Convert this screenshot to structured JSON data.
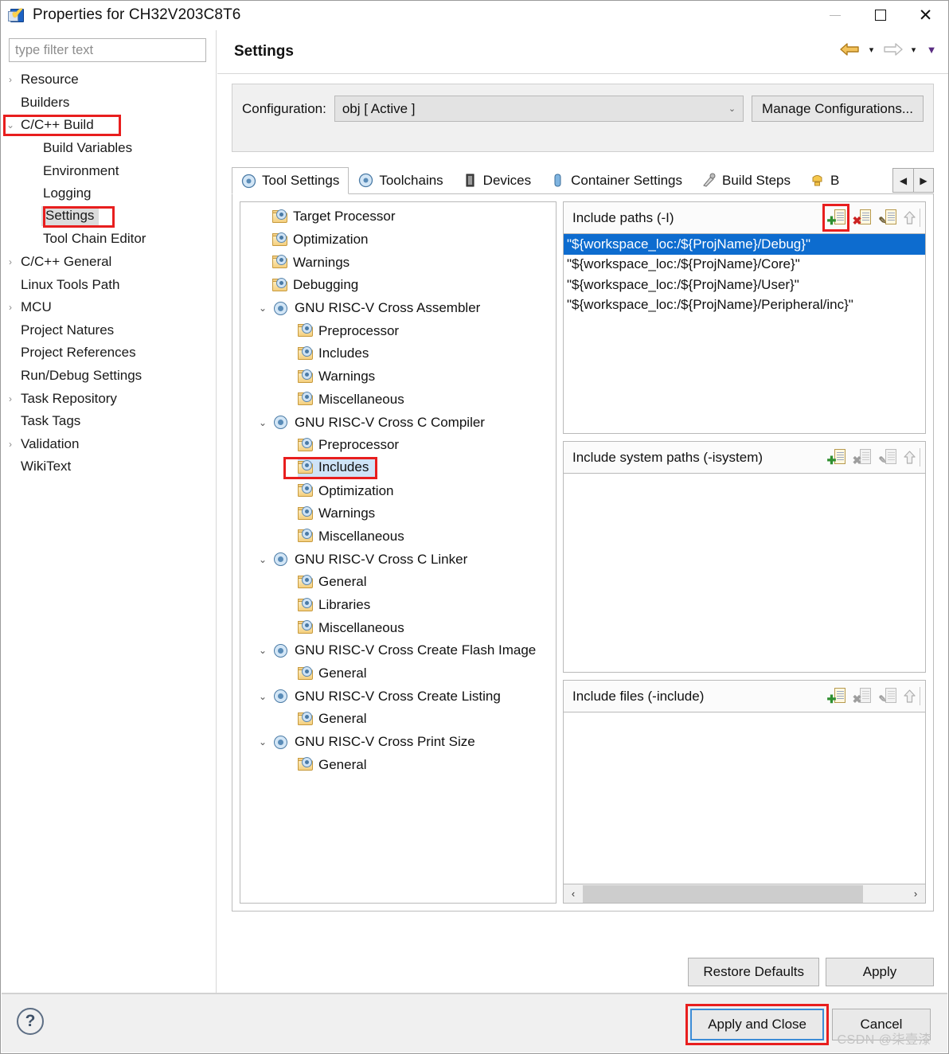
{
  "window": {
    "title": "Properties for CH32V203C8T6",
    "app_icon": "checkmark-app-icon",
    "minimize": "–",
    "maximize": "□",
    "close": "✕"
  },
  "sidebar": {
    "filter_placeholder": "type filter text",
    "filter_value": "",
    "items": [
      {
        "label": "Resource",
        "twisty": "›",
        "indent": 0,
        "selected": false,
        "boxed": false
      },
      {
        "label": "Builders",
        "twisty": "",
        "indent": 0,
        "selected": false,
        "boxed": false
      },
      {
        "label": "C/C++ Build",
        "twisty": "⌄",
        "indent": 0,
        "selected": false,
        "boxed": true
      },
      {
        "label": "Build Variables",
        "twisty": "",
        "indent": 1,
        "selected": false,
        "boxed": false
      },
      {
        "label": "Environment",
        "twisty": "",
        "indent": 1,
        "selected": false,
        "boxed": false
      },
      {
        "label": "Logging",
        "twisty": "",
        "indent": 1,
        "selected": false,
        "boxed": false
      },
      {
        "label": "Settings",
        "twisty": "",
        "indent": 1,
        "selected": true,
        "boxed": true
      },
      {
        "label": "Tool Chain Editor",
        "twisty": "",
        "indent": 1,
        "selected": false,
        "boxed": false
      },
      {
        "label": "C/C++ General",
        "twisty": "›",
        "indent": 0,
        "selected": false,
        "boxed": false
      },
      {
        "label": "Linux Tools Path",
        "twisty": "",
        "indent": 0,
        "selected": false,
        "boxed": false
      },
      {
        "label": "MCU",
        "twisty": "›",
        "indent": 0,
        "selected": false,
        "boxed": false
      },
      {
        "label": "Project Natures",
        "twisty": "",
        "indent": 0,
        "selected": false,
        "boxed": false
      },
      {
        "label": "Project References",
        "twisty": "",
        "indent": 0,
        "selected": false,
        "boxed": false
      },
      {
        "label": "Run/Debug Settings",
        "twisty": "",
        "indent": 0,
        "selected": false,
        "boxed": false
      },
      {
        "label": "Task Repository",
        "twisty": "›",
        "indent": 0,
        "selected": false,
        "boxed": false
      },
      {
        "label": "Task Tags",
        "twisty": "",
        "indent": 0,
        "selected": false,
        "boxed": false
      },
      {
        "label": "Validation",
        "twisty": "›",
        "indent": 0,
        "selected": false,
        "boxed": false
      },
      {
        "label": "WikiText",
        "twisty": "",
        "indent": 0,
        "selected": false,
        "boxed": false
      }
    ]
  },
  "page": {
    "title": "Settings",
    "nav": {
      "back_icon": "back-arrow-icon",
      "back_caret": "▾",
      "forward_icon": "forward-arrow-icon",
      "forward_caret": "▾",
      "menu_caret": "▼"
    },
    "configuration": {
      "label": "Configuration:",
      "value": "obj  [ Active ]",
      "caret": "⌄",
      "manage_button": "Manage Configurations..."
    }
  },
  "tabs": {
    "items": [
      {
        "label": "Tool Settings",
        "icon": "tool-settings-icon",
        "active": true
      },
      {
        "label": "Toolchains",
        "icon": "toolchains-icon",
        "active": false
      },
      {
        "label": "Devices",
        "icon": "devices-icon",
        "active": false
      },
      {
        "label": "Container Settings",
        "icon": "container-settings-icon",
        "active": false
      },
      {
        "label": "Build Steps",
        "icon": "build-steps-icon",
        "active": false
      },
      {
        "label": "B",
        "icon": "build-artifact-icon",
        "active": false
      }
    ],
    "scroll_left": "◀",
    "scroll_right": "▶"
  },
  "tool_tree": [
    {
      "label": "Target Processor",
      "level": 0,
      "twisty": "",
      "icon": "folder-gear-icon",
      "selected": false,
      "boxed": false
    },
    {
      "label": "Optimization",
      "level": 0,
      "twisty": "",
      "icon": "folder-gear-icon",
      "selected": false,
      "boxed": false
    },
    {
      "label": "Warnings",
      "level": 0,
      "twisty": "",
      "icon": "folder-gear-icon",
      "selected": false,
      "boxed": false
    },
    {
      "label": "Debugging",
      "level": 0,
      "twisty": "",
      "icon": "folder-gear-icon",
      "selected": false,
      "boxed": false
    },
    {
      "label": "GNU RISC-V Cross Assembler",
      "level": 0,
      "twisty": "⌄",
      "icon": "tool-disc-icon",
      "selected": false,
      "boxed": false
    },
    {
      "label": "Preprocessor",
      "level": 1,
      "twisty": "",
      "icon": "folder-gear-icon",
      "selected": false,
      "boxed": false
    },
    {
      "label": "Includes",
      "level": 1,
      "twisty": "",
      "icon": "folder-gear-icon",
      "selected": false,
      "boxed": false
    },
    {
      "label": "Warnings",
      "level": 1,
      "twisty": "",
      "icon": "folder-gear-icon",
      "selected": false,
      "boxed": false
    },
    {
      "label": "Miscellaneous",
      "level": 1,
      "twisty": "",
      "icon": "folder-gear-icon",
      "selected": false,
      "boxed": false
    },
    {
      "label": "GNU RISC-V Cross C Compiler",
      "level": 0,
      "twisty": "⌄",
      "icon": "tool-disc-icon",
      "selected": false,
      "boxed": false
    },
    {
      "label": "Preprocessor",
      "level": 1,
      "twisty": "",
      "icon": "folder-gear-icon",
      "selected": false,
      "boxed": false
    },
    {
      "label": "Includes",
      "level": 1,
      "twisty": "",
      "icon": "folder-gear-icon",
      "selected": true,
      "boxed": true
    },
    {
      "label": "Optimization",
      "level": 1,
      "twisty": "",
      "icon": "folder-gear-icon",
      "selected": false,
      "boxed": false
    },
    {
      "label": "Warnings",
      "level": 1,
      "twisty": "",
      "icon": "folder-gear-icon",
      "selected": false,
      "boxed": false
    },
    {
      "label": "Miscellaneous",
      "level": 1,
      "twisty": "",
      "icon": "folder-gear-icon",
      "selected": false,
      "boxed": false
    },
    {
      "label": "GNU RISC-V Cross C Linker",
      "level": 0,
      "twisty": "⌄",
      "icon": "tool-disc-icon",
      "selected": false,
      "boxed": false
    },
    {
      "label": "General",
      "level": 1,
      "twisty": "",
      "icon": "folder-gear-icon",
      "selected": false,
      "boxed": false
    },
    {
      "label": "Libraries",
      "level": 1,
      "twisty": "",
      "icon": "folder-gear-icon",
      "selected": false,
      "boxed": false
    },
    {
      "label": "Miscellaneous",
      "level": 1,
      "twisty": "",
      "icon": "folder-gear-icon",
      "selected": false,
      "boxed": false
    },
    {
      "label": "GNU RISC-V Cross Create Flash Image",
      "level": 0,
      "twisty": "⌄",
      "icon": "tool-disc-icon",
      "selected": false,
      "boxed": false
    },
    {
      "label": "General",
      "level": 1,
      "twisty": "",
      "icon": "folder-gear-icon",
      "selected": false,
      "boxed": false
    },
    {
      "label": "GNU RISC-V Cross Create Listing",
      "level": 0,
      "twisty": "⌄",
      "icon": "tool-disc-icon",
      "selected": false,
      "boxed": false
    },
    {
      "label": "General",
      "level": 1,
      "twisty": "",
      "icon": "folder-gear-icon",
      "selected": false,
      "boxed": false
    },
    {
      "label": "GNU RISC-V Cross Print Size",
      "level": 0,
      "twisty": "⌄",
      "icon": "tool-disc-icon",
      "selected": false,
      "boxed": false
    },
    {
      "label": "General",
      "level": 1,
      "twisty": "",
      "icon": "folder-gear-icon",
      "selected": false,
      "boxed": false
    }
  ],
  "panels": {
    "include_paths": {
      "title": "Include paths (-I)",
      "add_boxed": true,
      "tools": [
        {
          "name": "add-include-path-icon",
          "glyph": "✚",
          "enabled": true
        },
        {
          "name": "delete-include-path-icon",
          "glyph": "✖",
          "enabled": true
        },
        {
          "name": "edit-include-path-icon",
          "glyph": "✎",
          "enabled": true
        },
        {
          "name": "move-up-icon",
          "glyph": "⇧",
          "enabled": false
        }
      ],
      "entries": [
        {
          "value": "\"${workspace_loc:/${ProjName}/Debug}\"",
          "selected": true
        },
        {
          "value": "\"${workspace_loc:/${ProjName}/Core}\"",
          "selected": false
        },
        {
          "value": "\"${workspace_loc:/${ProjName}/User}\"",
          "selected": false
        },
        {
          "value": "\"${workspace_loc:/${ProjName}/Peripheral/inc}\"",
          "selected": false
        }
      ]
    },
    "include_system_paths": {
      "title": "Include system paths (-isystem)",
      "add_boxed": false,
      "tools": [
        {
          "name": "add-include-system-path-icon",
          "glyph": "✚",
          "enabled": true
        },
        {
          "name": "delete-include-system-path-icon",
          "glyph": "✖",
          "enabled": false
        },
        {
          "name": "edit-include-system-path-icon",
          "glyph": "✎",
          "enabled": false
        },
        {
          "name": "move-up-icon",
          "glyph": "⇧",
          "enabled": false
        }
      ],
      "entries": []
    },
    "include_files": {
      "title": "Include files (-include)",
      "add_boxed": false,
      "tools": [
        {
          "name": "add-include-file-icon",
          "glyph": "✚",
          "enabled": true
        },
        {
          "name": "delete-include-file-icon",
          "glyph": "✖",
          "enabled": false
        },
        {
          "name": "edit-include-file-icon",
          "glyph": "✎",
          "enabled": false
        },
        {
          "name": "move-up-icon",
          "glyph": "⇧",
          "enabled": false
        }
      ],
      "entries": []
    },
    "hscroll": {
      "left": "‹",
      "right": "›"
    }
  },
  "actions": {
    "restore_defaults": "Restore Defaults",
    "apply": "Apply",
    "apply_and_close": "Apply and Close",
    "cancel": "Cancel",
    "help_icon": "?"
  },
  "watermark": "CSDN @柒壹漆",
  "colors": {
    "selection_blue": "#0d6ccf",
    "soft_selection": "#cfe3f7",
    "annotation_red": "#e81e1e",
    "focus_blue": "#3c8cd6"
  }
}
